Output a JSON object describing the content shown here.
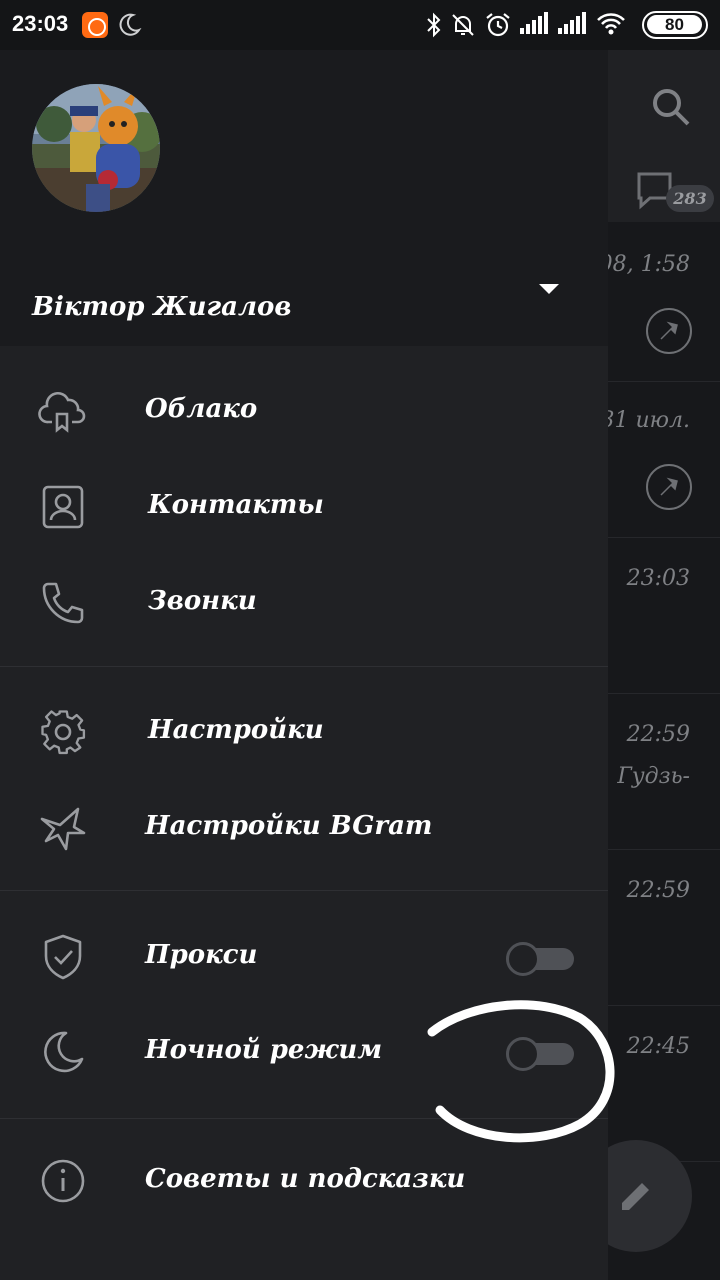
{
  "status_bar": {
    "time": "23:03",
    "battery": "80",
    "icons": [
      "app-notification-icon",
      "moon-icon",
      "bluetooth-icon",
      "mute-icon",
      "alarm-icon",
      "signal-icon",
      "signal-icon",
      "wifi-icon",
      "battery-icon"
    ]
  },
  "background_list": {
    "badge_count": "283",
    "rows": [
      {
        "time": "08, 1:58",
        "pinned": true
      },
      {
        "time": "31 июл.",
        "pinned": true
      },
      {
        "time": "23:03"
      },
      {
        "time": "22:59",
        "snippet": "Гудзь-"
      },
      {
        "time": "22:59"
      },
      {
        "time": "22:45"
      }
    ]
  },
  "drawer": {
    "user_name": "Віктор Жигалов",
    "items": [
      {
        "label": "Облако",
        "icon": "cloud-icon"
      },
      {
        "label": "Контакты",
        "icon": "contact-icon"
      },
      {
        "label": "Звонки",
        "icon": "phone-icon"
      },
      {
        "label": "Настройки",
        "icon": "gear-icon"
      },
      {
        "label": "Настройки BGram",
        "icon": "bird-icon"
      },
      {
        "label": "Прокси",
        "icon": "shield-icon",
        "toggle": false
      },
      {
        "label": "Ночной режим",
        "icon": "moon-icon",
        "toggle": false
      },
      {
        "label": "Советы и подсказки",
        "icon": "info-icon"
      }
    ]
  },
  "colors": {
    "drawer_bg": "#202124",
    "header_bg": "#1a1b1e",
    "icon": "#9a9ca0",
    "toggle_off": "#4f5156",
    "status_app": "#ff6a13"
  }
}
